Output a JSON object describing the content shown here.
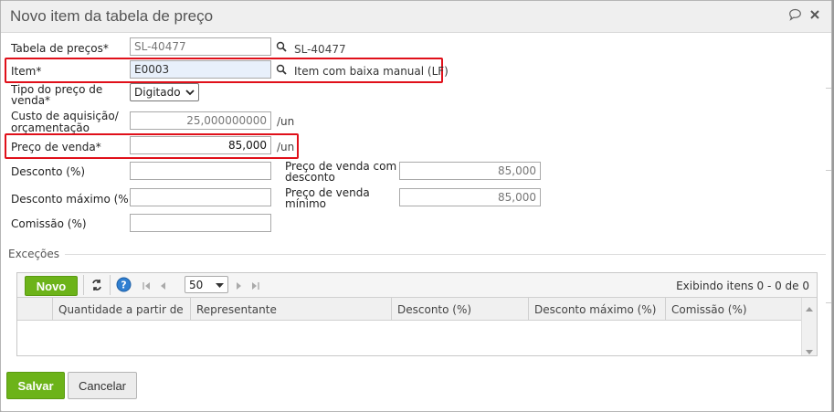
{
  "dialog": {
    "title": "Novo item da tabela de preço"
  },
  "form": {
    "tabela_label": "Tabela de preços*",
    "tabela_value": "SL-40477",
    "tabela_desc": "SL-40477",
    "item_label": "Item*",
    "item_value": "E0003",
    "item_desc": "Item com baixa manual (LF)",
    "tipo_label_1": "Tipo do preço de",
    "tipo_label_2": "venda*",
    "tipo_value": "Digitado",
    "custo_label_1": "Custo de aquisição/",
    "custo_label_2": "orçamentação",
    "custo_value": "25,000000000",
    "custo_unit": "/un",
    "preco_label": "Preço de venda*",
    "preco_value": "85,000",
    "preco_unit": "/un",
    "desconto_label": "Desconto (%)",
    "desconto_value": "",
    "desconto_max_label": "Desconto máximo (%)",
    "desconto_max_value": "",
    "comissao_label": "Comissão (%)",
    "comissao_value": "",
    "pv_desc_label_1": "Preço de venda com",
    "pv_desc_label_2": "desconto",
    "pv_desc_value": "85,000",
    "pv_min_label_1": "Preço de venda",
    "pv_min_label_2": "mínimo",
    "pv_min_value": "85,000"
  },
  "excecoes": {
    "legend": "Exceções",
    "novo_label": "Novo",
    "page_size": "50",
    "status": "Exibindo itens 0 - 0 de 0",
    "columns": [
      "Quantidade a partir de",
      "Representante",
      "Desconto (%)",
      "Desconto máximo (%)",
      "Comissão (%)"
    ]
  },
  "footer": {
    "salvar_label": "Salvar",
    "cancelar_label": "Cancelar"
  },
  "colors": {
    "accent_green": "#6cb319",
    "highlight_red": "#e0101a"
  }
}
